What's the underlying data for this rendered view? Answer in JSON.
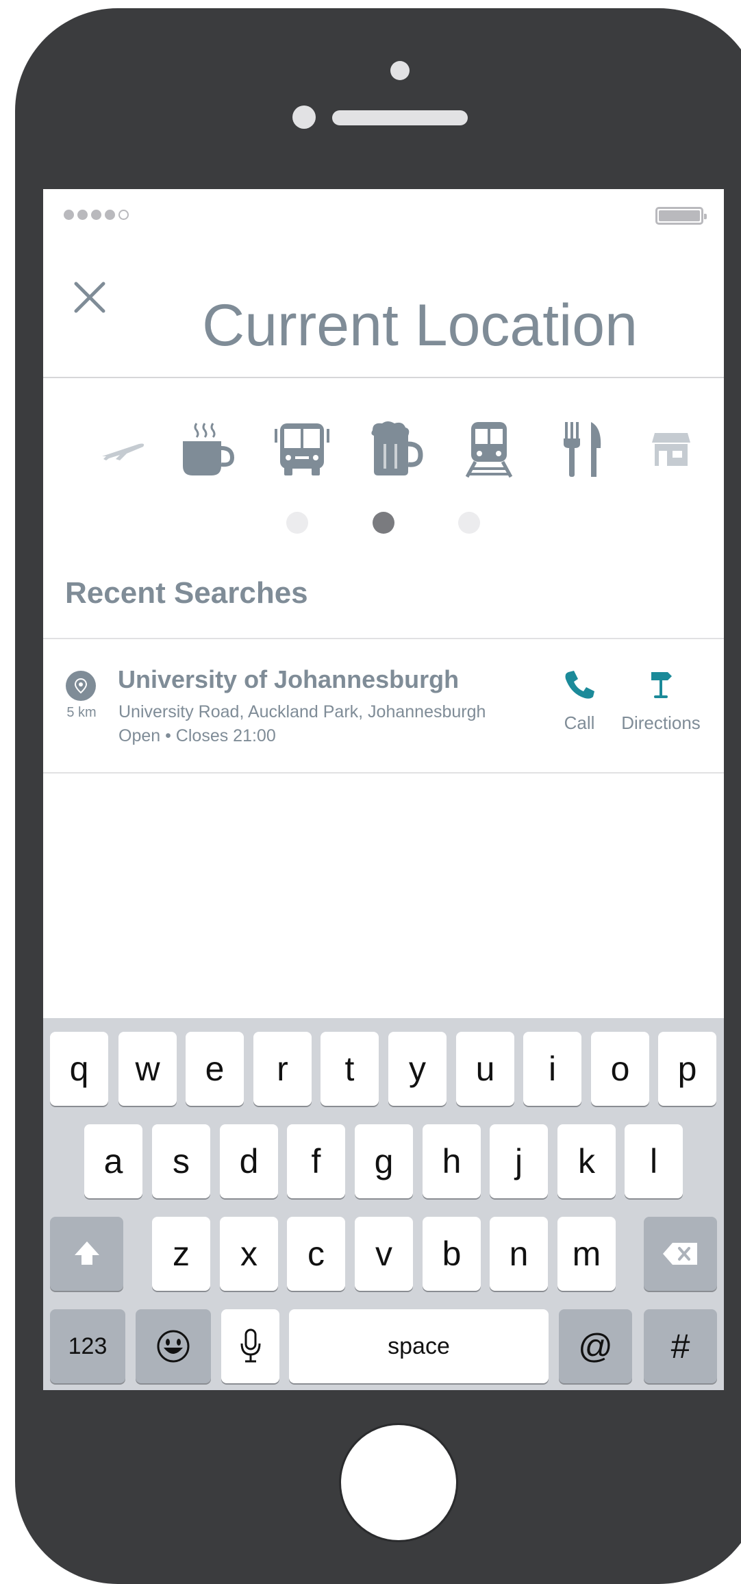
{
  "header": {
    "title": "Current Location",
    "close_icon": "close-icon"
  },
  "status_bar": {
    "signal_dots_filled": 4,
    "signal_dots_total": 5
  },
  "categories": [
    {
      "name": "airport",
      "icon": "airplane-icon"
    },
    {
      "name": "coffee",
      "icon": "coffee-icon"
    },
    {
      "name": "bus",
      "icon": "bus-icon"
    },
    {
      "name": "bar",
      "icon": "beer-icon"
    },
    {
      "name": "train",
      "icon": "train-icon"
    },
    {
      "name": "restaurant",
      "icon": "fork-knife-icon"
    },
    {
      "name": "shop",
      "icon": "store-icon"
    }
  ],
  "pagination": {
    "pages": 3,
    "active": 1
  },
  "recent": {
    "title": "Recent Searches",
    "items": [
      {
        "name": "University of Johannesburgh",
        "address": "University Road, Auckland Park, Johannesburgh",
        "hours": "Open • Closes 21:00",
        "distance": "5 km",
        "call_label": "Call",
        "directions_label": "Directions"
      }
    ]
  },
  "colors": {
    "accent": "#1b8a99",
    "text_gray": "#7f8c97",
    "phone_body": "#3b3c3e"
  },
  "keyboard": {
    "row1": [
      "q",
      "w",
      "e",
      "r",
      "t",
      "y",
      "u",
      "i",
      "o",
      "p"
    ],
    "row2": [
      "a",
      "s",
      "d",
      "f",
      "g",
      "h",
      "j",
      "k",
      "l"
    ],
    "row3": [
      "z",
      "x",
      "c",
      "v",
      "b",
      "n",
      "m"
    ],
    "numbers_label": "123",
    "space_label": "space",
    "at_label": "@",
    "hash_label": "#"
  }
}
